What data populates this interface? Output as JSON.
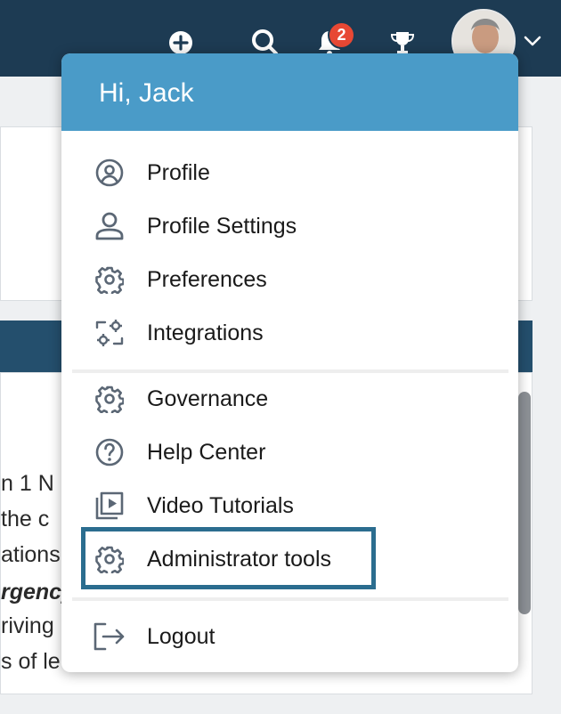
{
  "topbar": {
    "notification_count": "2",
    "icons": [
      "add-icon",
      "search-icon",
      "bell-icon",
      "trophy-icon",
      "chevron-down-icon"
    ]
  },
  "background_text": [
    "n 1 N",
    "the c",
    "ations",
    "rgency",
    "riving",
    "s of le"
  ],
  "menu": {
    "greeting": "Hi, Jack",
    "items": [
      {
        "label": "Profile",
        "icon": "profile-circle-icon"
      },
      {
        "label": "Profile Settings",
        "icon": "person-icon"
      },
      {
        "label": "Preferences",
        "icon": "gear-icon"
      },
      {
        "label": "Integrations",
        "icon": "integrations-icon"
      },
      {
        "label": "Governance",
        "icon": "gear-icon"
      },
      {
        "label": "Help Center",
        "icon": "help-icon"
      },
      {
        "label": "Video Tutorials",
        "icon": "video-icon"
      },
      {
        "label": "Administrator tools",
        "icon": "gear-icon"
      },
      {
        "label": "Logout",
        "icon": "logout-icon"
      }
    ],
    "highlighted_item": "Administrator tools"
  },
  "colors": {
    "topbar": "#1d3b53",
    "menu_header": "#4a9bc8",
    "highlight_border": "#2b6d8f",
    "badge": "#e74834"
  }
}
